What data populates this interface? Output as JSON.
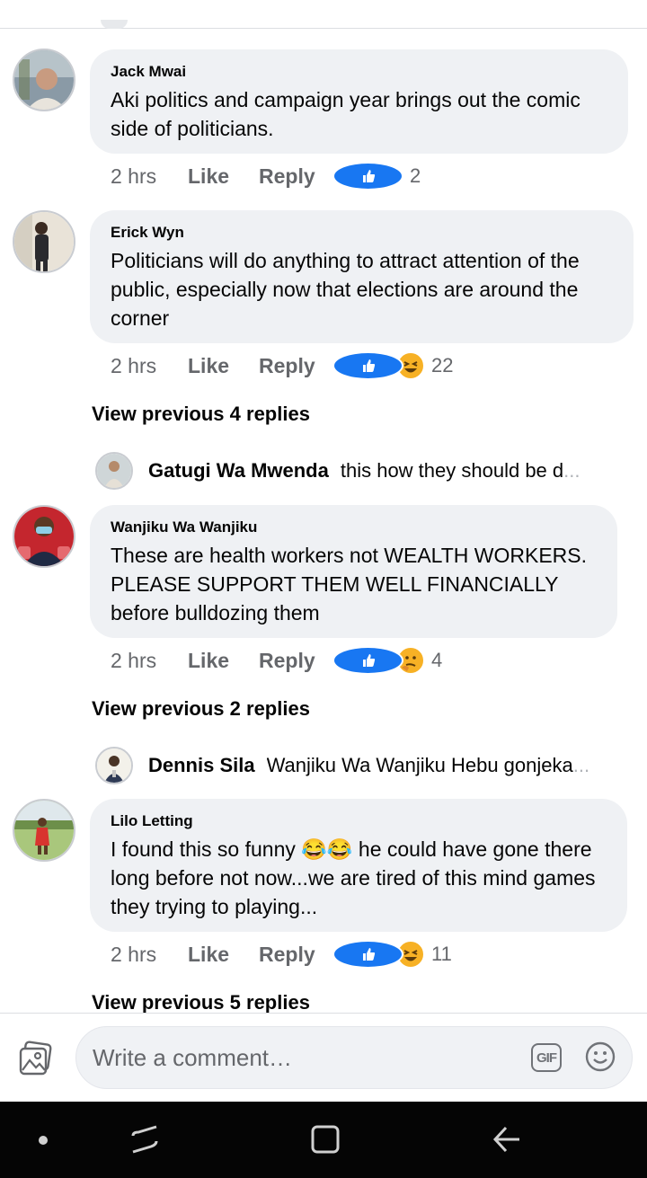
{
  "comments": [
    {
      "name": "Jack Mwai",
      "text": "Aki politics and campaign year brings out the comic side of politicians.",
      "time": "2 hrs",
      "like_label": "Like",
      "reply_label": "Reply",
      "reactions": [
        "like"
      ],
      "reaction_count": "2"
    },
    {
      "name": "Erick Wyn",
      "text": "Politicians will do anything to attract attention of the public, especially now that elections are around the corner",
      "time": "2 hrs",
      "like_label": "Like",
      "reply_label": "Reply",
      "reactions": [
        "like",
        "haha"
      ],
      "reaction_count": "22",
      "view_previous": "View previous 4 replies",
      "latest_reply": {
        "name": "Gatugi Wa Mwenda",
        "text": "this how they should be d",
        "ellipsis": "..."
      }
    },
    {
      "name": "Wanjiku Wa Wanjiku",
      "text": "These are health workers not WEALTH WORKERS. PLEASE SUPPORT THEM WELL FINANCIALLY before bulldozing them",
      "time": "2 hrs",
      "like_label": "Like",
      "reply_label": "Reply",
      "reactions": [
        "like",
        "thinking"
      ],
      "reaction_count": "4",
      "view_previous": "View previous 2 replies",
      "latest_reply": {
        "name": "Dennis Sila",
        "text": "Wanjiku Wa Wanjiku Hebu gonjeka",
        "ellipsis": "..."
      }
    },
    {
      "name": "Lilo Letting",
      "text_before_emoji": "I found this so funny ",
      "emoji": "😂😂",
      "text_after_emoji": " he could have gone there long before not now...we are tired of this mind games they trying to playing...",
      "time": "2 hrs",
      "like_label": "Like",
      "reply_label": "Reply",
      "reactions": [
        "like",
        "haha"
      ],
      "reaction_count": "11",
      "view_previous": "View previous 5 replies"
    }
  ],
  "composer": {
    "placeholder": "Write a comment…",
    "gif_label": "GIF",
    "photo_icon": "photo-icon",
    "emoji_icon": "smiley-icon"
  },
  "colors": {
    "bubble": "#eff1f4",
    "like_blue": "#1877f2",
    "secondary_text": "#65676b",
    "navbar": "#050505"
  }
}
